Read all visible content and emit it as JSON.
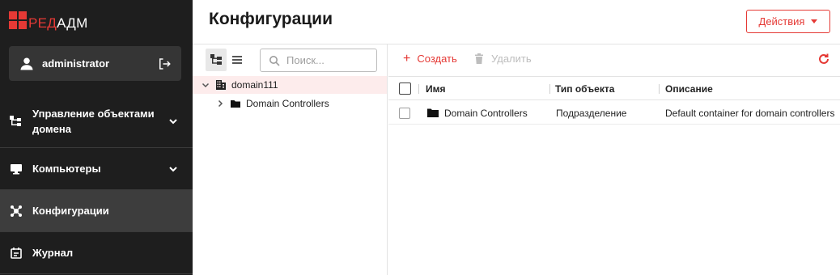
{
  "brand": {
    "logo_red": "РЕД",
    "logo_white": "АДМ"
  },
  "user": {
    "name": "administrator"
  },
  "nav": [
    {
      "label": "Управление объектами домена",
      "icon": "domain-tree-icon"
    },
    {
      "label": "Компьютеры",
      "icon": "monitor-icon"
    },
    {
      "label": "Конфигурации",
      "icon": "configuration-icon"
    },
    {
      "label": "Журнал",
      "icon": "journal-icon"
    }
  ],
  "page": {
    "title": "Конфигурации",
    "actions_label": "Действия"
  },
  "tree": {
    "search_placeholder": "Поиск...",
    "items": [
      {
        "label": "domain111"
      },
      {
        "label": "Domain Controllers"
      }
    ]
  },
  "toolbar": {
    "create_label": "Создать",
    "delete_label": "Удалить"
  },
  "table": {
    "columns": [
      "Имя",
      "Тип объекта",
      "Описание"
    ],
    "rows": [
      {
        "name": "Domain Controllers",
        "type": "Подразделение",
        "description": "Default container for domain controllers"
      }
    ]
  },
  "colors": {
    "accent": "#e53935",
    "sidebar_bg": "#1e1e1e",
    "selected_row": "#fdecec"
  }
}
